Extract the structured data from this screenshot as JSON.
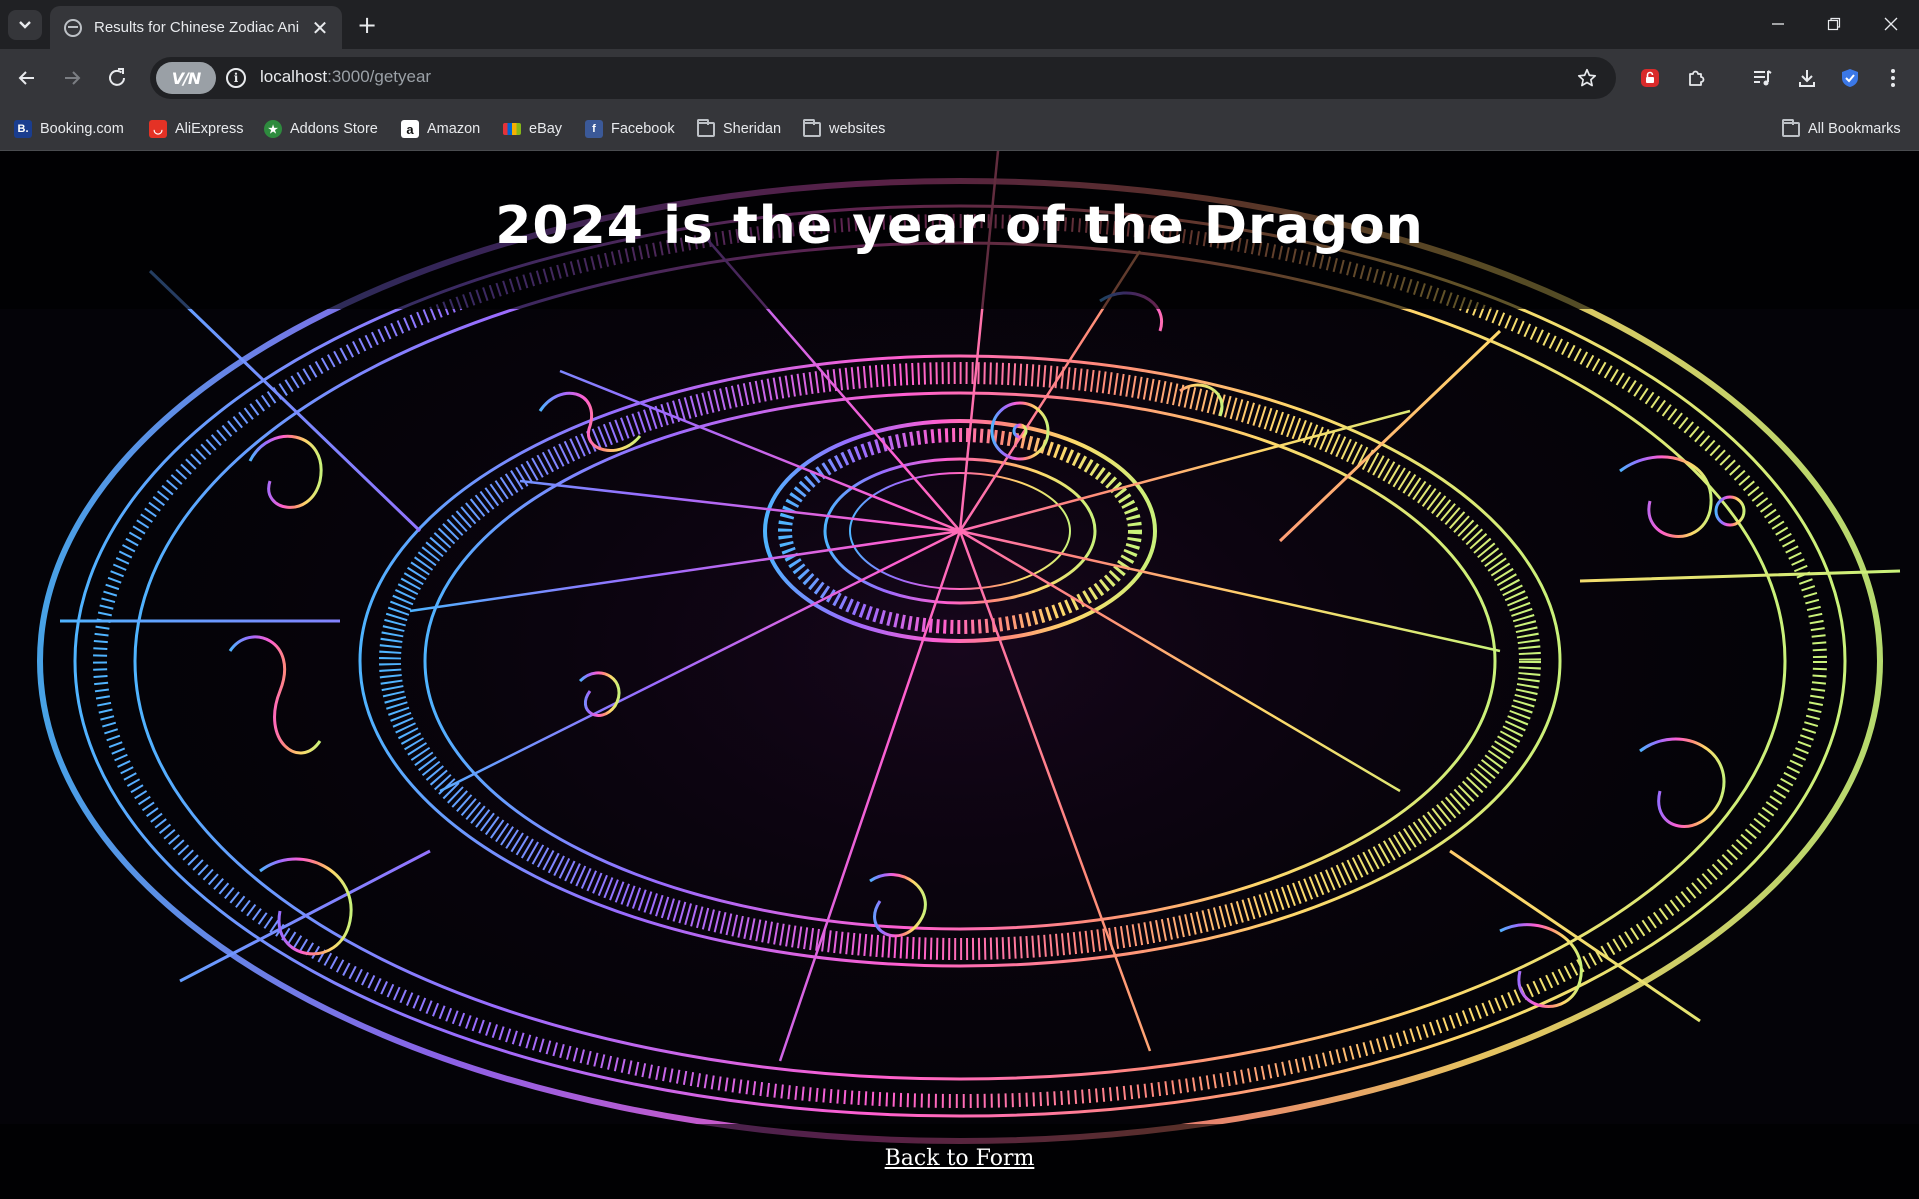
{
  "browser": {
    "tab_title": "Results for Chinese Zodiac Animal",
    "url_host": "localhost",
    "url_path": ":3000/getyear",
    "vpn_label": "V/N"
  },
  "bookmarks": [
    {
      "label": "Booking.com",
      "icon": "booking-icon",
      "color": "#1a3d8f",
      "glyph": "B."
    },
    {
      "label": "AliExpress",
      "icon": "aliexpress-icon",
      "color": "#e43225",
      "glyph": "◡"
    },
    {
      "label": "Addons Store",
      "icon": "addons-store-icon",
      "color": "#2e8b3e",
      "glyph": "★"
    },
    {
      "label": "Amazon",
      "icon": "amazon-icon",
      "color": "#ffffff",
      "glyph": "a"
    },
    {
      "label": "eBay",
      "icon": "ebay-icon",
      "color": "#e53238",
      "glyph": ""
    },
    {
      "label": "Facebook",
      "icon": "facebook-icon",
      "color": "#3b5998",
      "glyph": "f"
    },
    {
      "label": "Sheridan",
      "icon": "folder-icon"
    },
    {
      "label": "websites",
      "icon": "folder-icon"
    }
  ],
  "all_bookmarks_label": "All Bookmarks",
  "page": {
    "headline": "2024 is the year of the Dragon",
    "back_link": "Back to Form"
  }
}
